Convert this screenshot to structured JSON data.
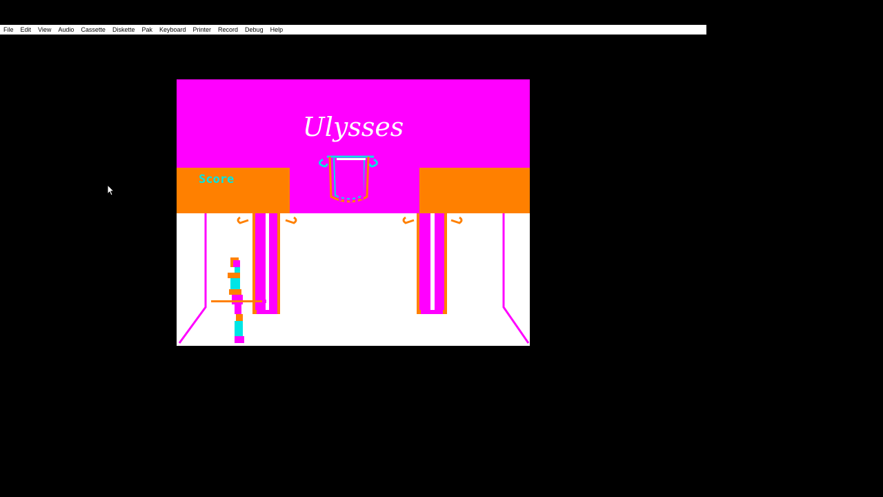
{
  "menu": [
    "File",
    "Edit",
    "View",
    "Audio",
    "Cassette",
    "Diskette",
    "Pak",
    "Keyboard",
    "Printer",
    "Record",
    "Debug",
    "Help"
  ],
  "game": {
    "title": "Ulysses",
    "score_label": "Score"
  },
  "colors": {
    "magenta": "#ff00ff",
    "orange": "#ff8000",
    "cyan": "#00e5e5",
    "white": "#ffffff",
    "black": "#000000"
  }
}
